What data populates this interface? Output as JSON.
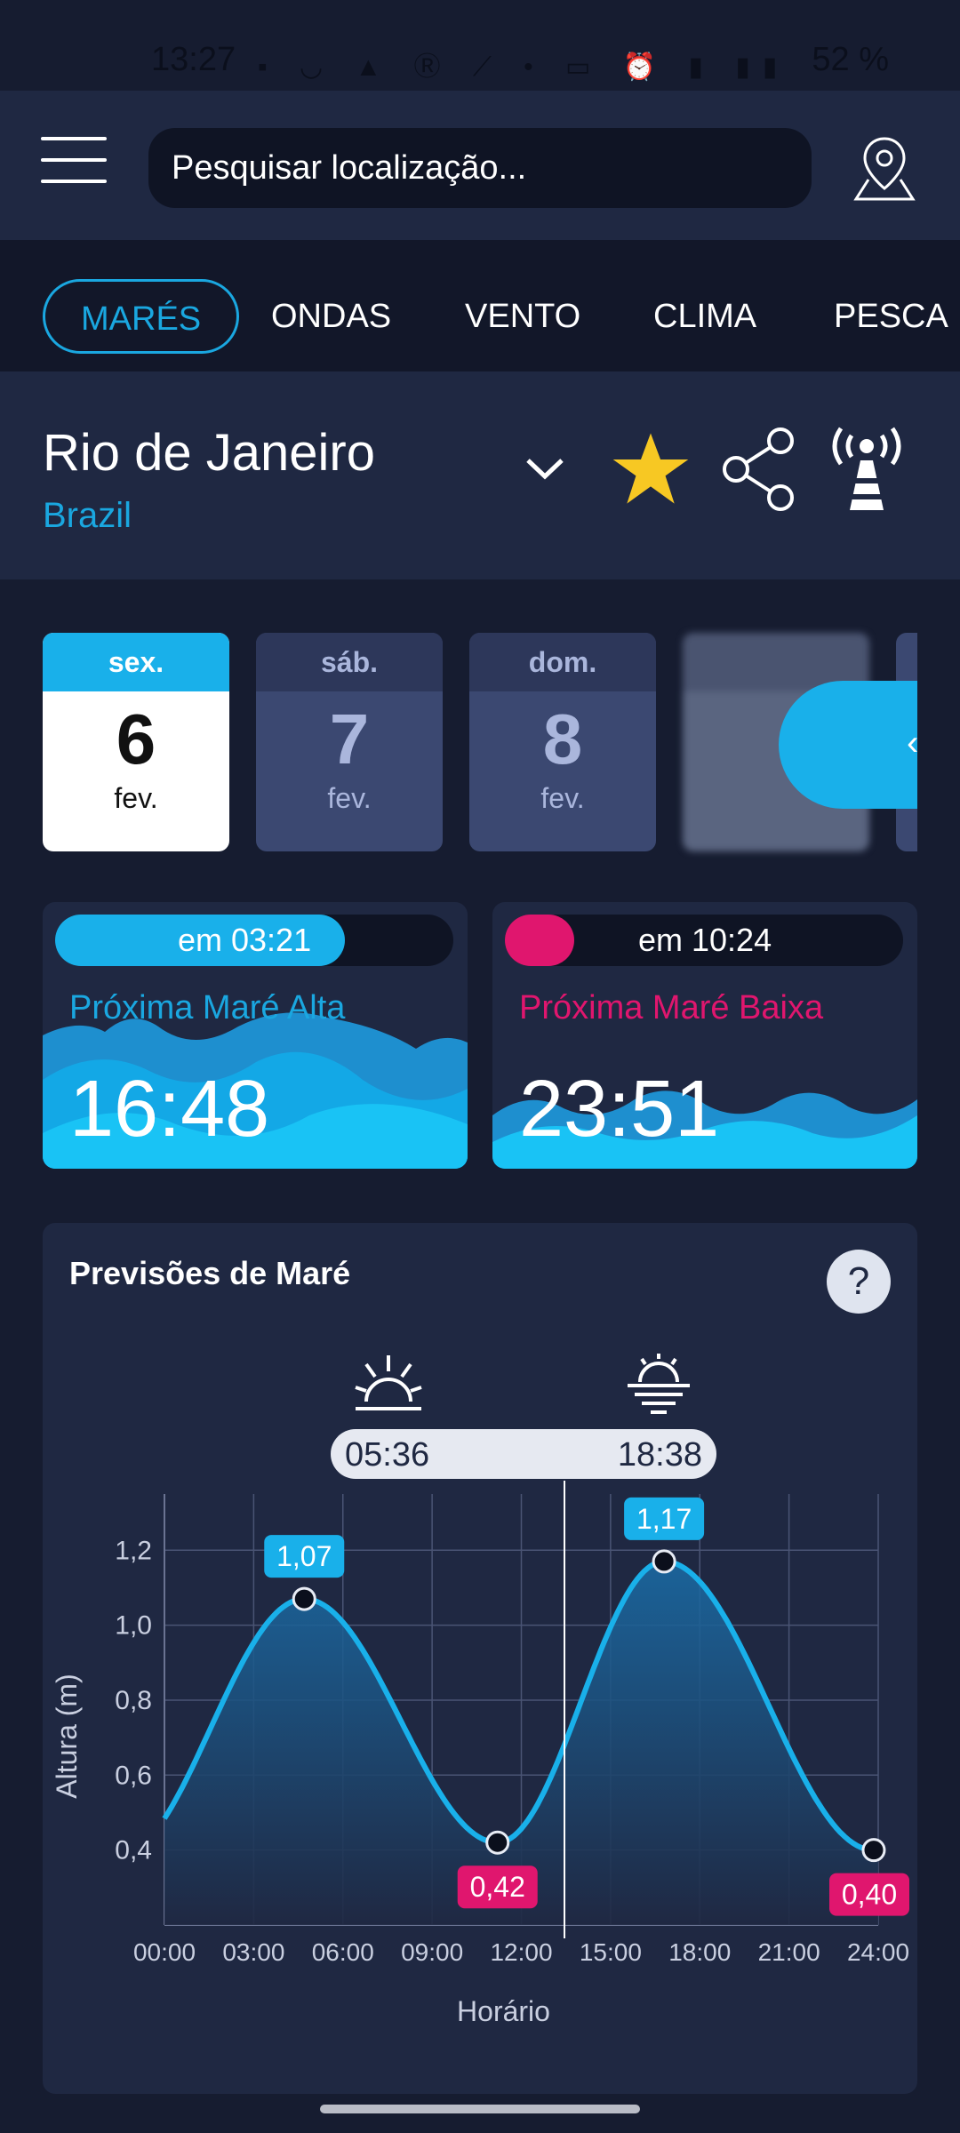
{
  "status_bar": {
    "time": "13:27",
    "battery": "52 %",
    "icons": [
      "message-icon",
      "cloud-icon",
      "alert-icon",
      "r-icon",
      "chart-icon",
      "dot-icon",
      "vpn-icon",
      "alarm-icon",
      "volte-icon",
      "signal-icon"
    ]
  },
  "header": {
    "search_placeholder": "Pesquisar localização..."
  },
  "tabs": [
    {
      "label": "MARÉS",
      "active": true
    },
    {
      "label": "ONDAS"
    },
    {
      "label": "VENTO"
    },
    {
      "label": "CLIMA"
    },
    {
      "label": "PESCA"
    }
  ],
  "location": {
    "city": "Rio de Janeiro",
    "country": "Brazil"
  },
  "days": [
    {
      "weekday": "sex.",
      "day": "6",
      "month": "fev.",
      "active": true
    },
    {
      "weekday": "sáb.",
      "day": "7",
      "month": "fev."
    },
    {
      "weekday": "dom.",
      "day": "8",
      "month": "fev."
    }
  ],
  "next_high": {
    "countdown": "em 03:21",
    "label": "Próxima Maré Alta",
    "time": "16:48"
  },
  "next_low": {
    "countdown": "em 10:24",
    "label": "Próxima Maré Baixa",
    "time": "23:51"
  },
  "forecast": {
    "title": "Previsões de Maré",
    "help": "?",
    "sunrise": "05:36",
    "sunset": "18:38"
  },
  "colors": {
    "accent": "#1aa7e0",
    "low": "#e0166e",
    "bg": "#161c30",
    "panel": "#1f2842"
  },
  "chart_data": {
    "type": "line",
    "xlabel": "Horário",
    "ylabel": "Altura (m)",
    "x_ticks": [
      "00:00",
      "03:00",
      "06:00",
      "09:00",
      "12:00",
      "15:00",
      "18:00",
      "21:00",
      "24:00"
    ],
    "y_ticks": [
      "0,4",
      "0,6",
      "0,8",
      "1,0",
      "1,2"
    ],
    "ylim": [
      0.2,
      1.35
    ],
    "xlim": [
      0,
      24
    ],
    "extremes": [
      {
        "hour": 4.7,
        "value": 1.07,
        "label": "1,07",
        "kind": "high"
      },
      {
        "hour": 11.2,
        "value": 0.42,
        "label": "0,42",
        "kind": "low"
      },
      {
        "hour": 16.8,
        "value": 1.17,
        "label": "1,17",
        "kind": "high"
      },
      {
        "hour": 23.85,
        "value": 0.4,
        "label": "0,40",
        "kind": "low"
      }
    ],
    "start_value": 0.51,
    "current_hour": 13.45,
    "grid": true
  }
}
